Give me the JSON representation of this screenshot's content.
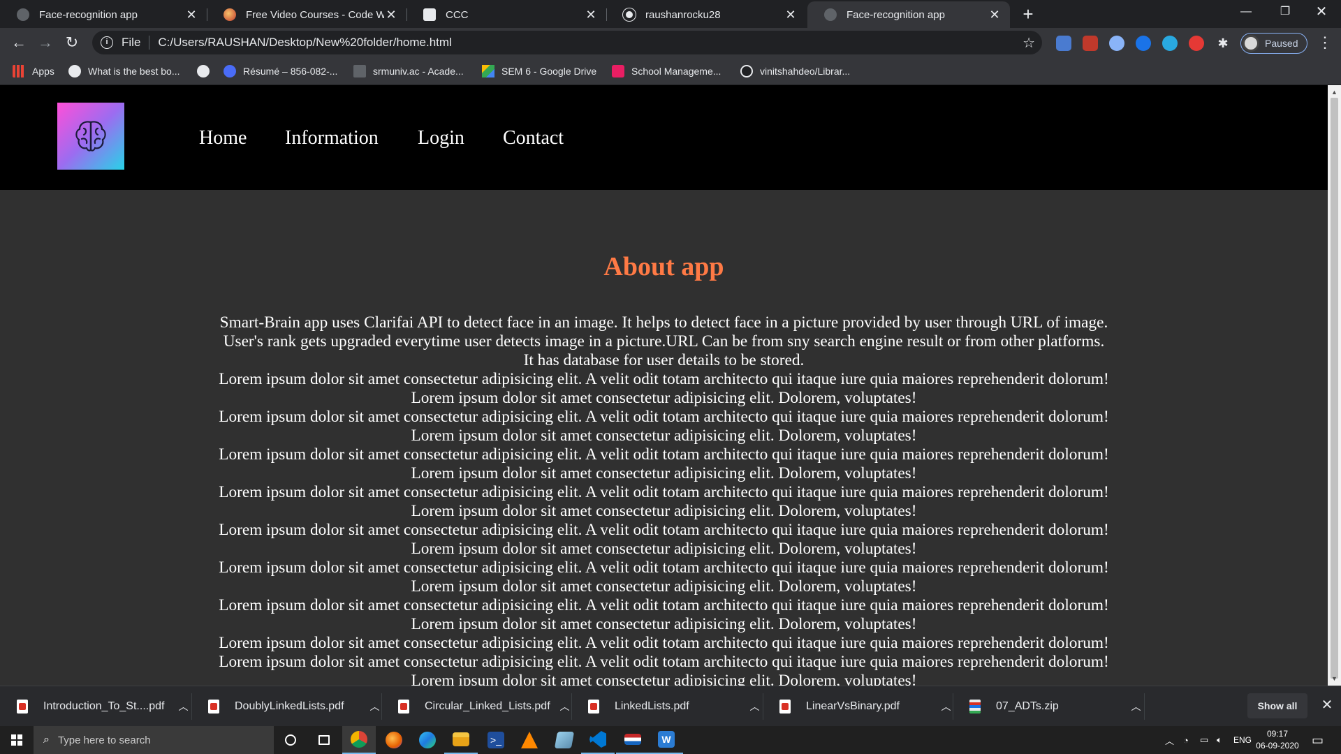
{
  "browser": {
    "tabs": [
      {
        "title": "Face-recognition app",
        "active": false
      },
      {
        "title": "Free Video Courses - Code With Harry",
        "active": false
      },
      {
        "title": "CCC",
        "active": false
      },
      {
        "title": "raushanrocku28",
        "active": false
      },
      {
        "title": "Face-recognition app",
        "active": true
      }
    ],
    "address": {
      "scheme": "File",
      "url": "C:/Users/RAUSHAN/Desktop/New%20folder/home.html"
    },
    "profile_label": "Paused",
    "bookmarks": [
      {
        "label": "Apps"
      },
      {
        "label": "What is the best bo..."
      },
      {
        "label": ""
      },
      {
        "label": "Résumé – 856-082-..."
      },
      {
        "label": "srmuniv.ac - Acade..."
      },
      {
        "label": "SEM 6 - Google Drive"
      },
      {
        "label": "School Manageme..."
      },
      {
        "label": "vinitshahdeo/Librar..."
      }
    ]
  },
  "site": {
    "nav": [
      {
        "label": "Home"
      },
      {
        "label": "Information"
      },
      {
        "label": "Login"
      },
      {
        "label": "Contact"
      }
    ],
    "about_title": "About app",
    "about_lines": [
      "Smart-Brain app uses Clarifai API to detect face in an image. It helps to detect face in a picture provided by user through URL of image.",
      "User's rank gets upgraded everytime user detects image in a picture.URL Can be from sny search engine result or from other platforms.",
      "It has database for user details to be stored.",
      "Lorem ipsum dolor sit amet consectetur adipisicing elit. A velit odit totam architecto qui itaque iure quia maiores reprehenderit dolorum!",
      "Lorem ipsum dolor sit amet consectetur adipisicing elit. Dolorem, voluptates!",
      "Lorem ipsum dolor sit amet consectetur adipisicing elit. A velit odit totam architecto qui itaque iure quia maiores reprehenderit dolorum!",
      "Lorem ipsum dolor sit amet consectetur adipisicing elit. Dolorem, voluptates!",
      "Lorem ipsum dolor sit amet consectetur adipisicing elit. A velit odit totam architecto qui itaque iure quia maiores reprehenderit dolorum!",
      "Lorem ipsum dolor sit amet consectetur adipisicing elit. Dolorem, voluptates!",
      "Lorem ipsum dolor sit amet consectetur adipisicing elit. A velit odit totam architecto qui itaque iure quia maiores reprehenderit dolorum!",
      "Lorem ipsum dolor sit amet consectetur adipisicing elit. Dolorem, voluptates!",
      "Lorem ipsum dolor sit amet consectetur adipisicing elit. A velit odit totam architecto qui itaque iure quia maiores reprehenderit dolorum!",
      "Lorem ipsum dolor sit amet consectetur adipisicing elit. Dolorem, voluptates!",
      "Lorem ipsum dolor sit amet consectetur adipisicing elit. A velit odit totam architecto qui itaque iure quia maiores reprehenderit dolorum!",
      "Lorem ipsum dolor sit amet consectetur adipisicing elit. Dolorem, voluptates!",
      "Lorem ipsum dolor sit amet consectetur adipisicing elit. A velit odit totam architecto qui itaque iure quia maiores reprehenderit dolorum!",
      "Lorem ipsum dolor sit amet consectetur adipisicing elit. Dolorem, voluptates!",
      "Lorem ipsum dolor sit amet consectetur adipisicing elit. A velit odit totam architecto qui itaque iure quia maiores reprehenderit dolorum!",
      "Lorem ipsum dolor sit amet consectetur adipisicing elit. A velit odit totam architecto qui itaque iure quia maiores reprehenderit dolorum!",
      "Lorem ipsum dolor sit amet consectetur adipisicing elit. Dolorem, voluptates!"
    ],
    "colors": {
      "title": "#ff7a45",
      "header_bg": "#000000",
      "page_bg": "#303030"
    }
  },
  "downloads": {
    "items": [
      {
        "name": "Introduction_To_St....pdf",
        "icon": "pdf-icon"
      },
      {
        "name": "DoublyLinkedLists.pdf",
        "icon": "pdf-icon"
      },
      {
        "name": "Circular_Linked_Lists.pdf",
        "icon": "pdf-icon"
      },
      {
        "name": "LinkedLists.pdf",
        "icon": "pdf-icon"
      },
      {
        "name": "LinearVsBinary.pdf",
        "icon": "pdf-icon"
      },
      {
        "name": "07_ADTs.zip",
        "icon": "zip-icon"
      }
    ],
    "show_all": "Show all"
  },
  "taskbar": {
    "search_placeholder": "Type here to search",
    "language": "ENG",
    "time": "09:17",
    "date": "06-09-2020"
  }
}
